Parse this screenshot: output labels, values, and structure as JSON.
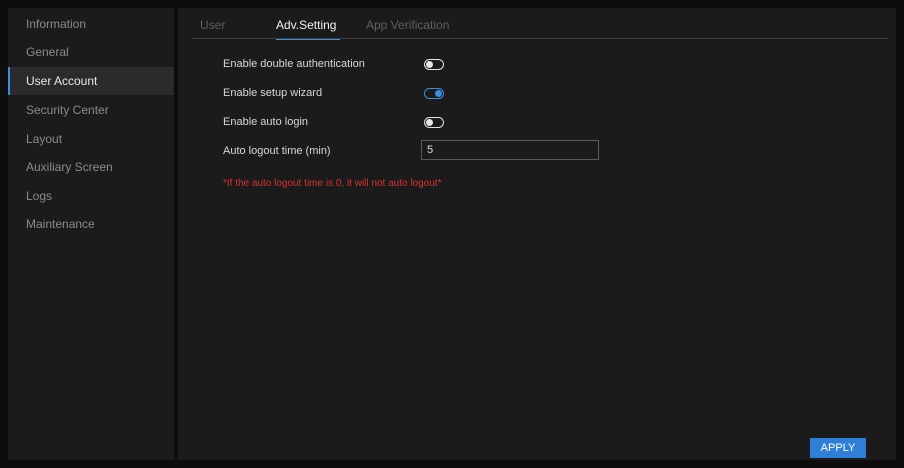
{
  "sidebar": {
    "items": [
      {
        "label": "Information"
      },
      {
        "label": "General"
      },
      {
        "label": "User Account"
      },
      {
        "label": "Security Center"
      },
      {
        "label": "Layout"
      },
      {
        "label": "Auxiliary Screen"
      },
      {
        "label": "Logs"
      },
      {
        "label": "Maintenance"
      }
    ],
    "active_index": 2
  },
  "tabs": [
    {
      "label": "User"
    },
    {
      "label": "Adv.Setting"
    },
    {
      "label": "App Verification"
    }
  ],
  "active_tab_index": 1,
  "settings": {
    "double_auth": {
      "label": "Enable double authentication",
      "enabled": false
    },
    "setup_wizard": {
      "label": "Enable setup wizard",
      "enabled": true
    },
    "auto_login": {
      "label": "Enable auto login",
      "enabled": false
    },
    "auto_logout": {
      "label": "Auto logout time (min)",
      "value": "5"
    }
  },
  "warning_text": "*If the auto logout time is 0, it will not auto logout*",
  "apply_label": "APPLY",
  "colors": {
    "accent": "#3c8fe0",
    "warning": "#d8322e",
    "panel": "#1b1b1c"
  }
}
